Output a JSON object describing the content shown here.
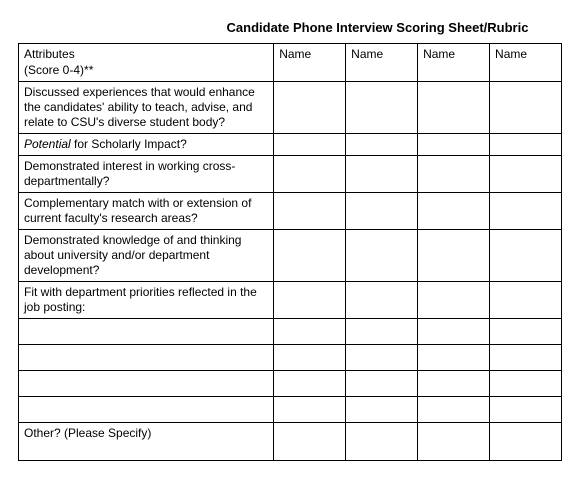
{
  "title": "Candidate Phone Interview Scoring Sheet/Rubric",
  "header": {
    "attributes_line1": "Attributes",
    "attributes_line2": "(Score 0-4)**",
    "name1": "Name",
    "name2": "Name",
    "name3": "Name",
    "name4": "Name"
  },
  "rows": {
    "r1": "Discussed experiences that would enhance the candidates' ability to teach, advise, and relate to CSU's diverse student body?",
    "r2_italic": "Potential",
    "r2_rest": " for Scholarly Impact?",
    "r3": "Demonstrated interest in working cross-departmentally?",
    "r4": "Complementary match with or extension of current faculty's research areas?",
    "r5": "Demonstrated knowledge of and thinking about university and/or department development?",
    "r6": "Fit with department priorities reflected in the job posting:",
    "r_other": "Other? (Please Specify)"
  }
}
